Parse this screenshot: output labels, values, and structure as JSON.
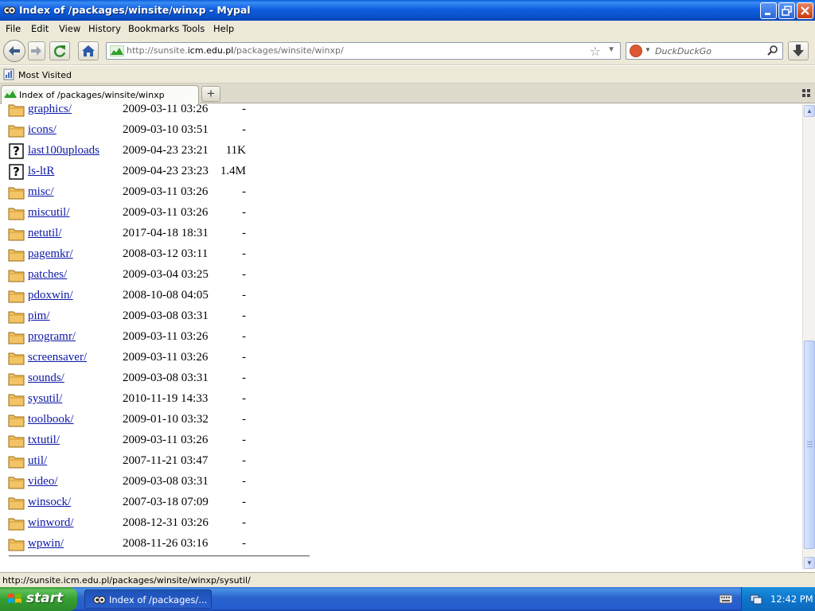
{
  "window": {
    "title": "Index of /packages/winsite/winxp - Mypal"
  },
  "menu": [
    "File",
    "Edit",
    "View",
    "History",
    "Bookmarks",
    "Tools",
    "Help"
  ],
  "navbar": {
    "url_prefix": "http://sunsite.",
    "url_host": "icm.edu.pl",
    "url_path": "/packages/winsite/winxp/",
    "search_placeholder": "DuckDuckGo"
  },
  "bookmarks": {
    "most_visited": "Most Visited"
  },
  "tab": {
    "title": "Index of /packages/winsite/winxp"
  },
  "listing": [
    {
      "name": "graphics/",
      "date": "2009-03-11 03:26",
      "size": "-",
      "type": "folder"
    },
    {
      "name": "icons/",
      "date": "2009-03-10 03:51",
      "size": "-",
      "type": "folder"
    },
    {
      "name": "last100uploads",
      "date": "2009-04-23 23:21",
      "size": "11K",
      "type": "file"
    },
    {
      "name": "ls-ltR",
      "date": "2009-04-23 23:23",
      "size": "1.4M",
      "type": "file"
    },
    {
      "name": "misc/",
      "date": "2009-03-11 03:26",
      "size": "-",
      "type": "folder"
    },
    {
      "name": "miscutil/",
      "date": "2009-03-11 03:26",
      "size": "-",
      "type": "folder"
    },
    {
      "name": "netutil/",
      "date": "2017-04-18 18:31",
      "size": "-",
      "type": "folder"
    },
    {
      "name": "pagemkr/",
      "date": "2008-03-12 03:11",
      "size": "-",
      "type": "folder"
    },
    {
      "name": "patches/",
      "date": "2009-03-04 03:25",
      "size": "-",
      "type": "folder"
    },
    {
      "name": "pdoxwin/",
      "date": "2008-10-08 04:05",
      "size": "-",
      "type": "folder"
    },
    {
      "name": "pim/",
      "date": "2009-03-08 03:31",
      "size": "-",
      "type": "folder"
    },
    {
      "name": "programr/",
      "date": "2009-03-11 03:26",
      "size": "-",
      "type": "folder"
    },
    {
      "name": "screensaver/",
      "date": "2009-03-11 03:26",
      "size": "-",
      "type": "folder"
    },
    {
      "name": "sounds/",
      "date": "2009-03-08 03:31",
      "size": "-",
      "type": "folder"
    },
    {
      "name": "sysutil/",
      "date": "2010-11-19 14:33",
      "size": "-",
      "type": "folder"
    },
    {
      "name": "toolbook/",
      "date": "2009-01-10 03:32",
      "size": "-",
      "type": "folder"
    },
    {
      "name": "txtutil/",
      "date": "2009-03-11 03:26",
      "size": "-",
      "type": "folder"
    },
    {
      "name": "util/",
      "date": "2007-11-21 03:47",
      "size": "-",
      "type": "folder"
    },
    {
      "name": "video/",
      "date": "2009-03-08 03:31",
      "size": "-",
      "type": "folder"
    },
    {
      "name": "winsock/",
      "date": "2007-03-18 07:09",
      "size": "-",
      "type": "folder"
    },
    {
      "name": "winword/",
      "date": "2008-12-31 03:26",
      "size": "-",
      "type": "folder"
    },
    {
      "name": "wpwin/",
      "date": "2008-11-26 03:16",
      "size": "-",
      "type": "folder"
    }
  ],
  "statusbar": {
    "text": "http://sunsite.icm.edu.pl/packages/winsite/winxp/sysutil/"
  },
  "taskbar": {
    "start_label": "start",
    "task_label": "Index of /packages/...",
    "clock": "12:42 PM"
  },
  "colors": {
    "link": "#0d17a6",
    "titlebar": "#0a4fc9",
    "chrome": "#ece9d8",
    "taskbar": "#245dd0",
    "start": "#36a033"
  }
}
